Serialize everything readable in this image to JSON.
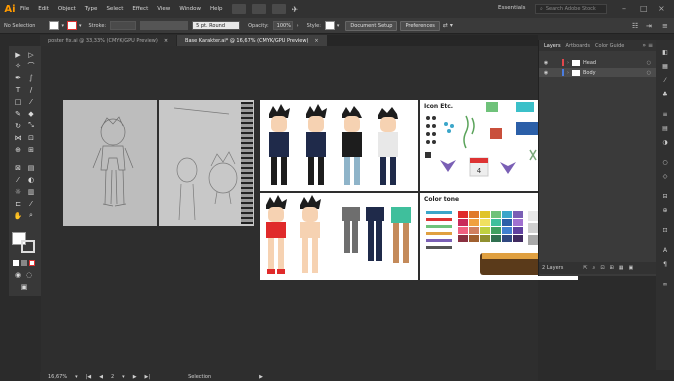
{
  "app": {
    "logo": "Ai"
  },
  "menu": [
    "File",
    "Edit",
    "Object",
    "Type",
    "Select",
    "Effect",
    "View",
    "Window",
    "Help"
  ],
  "workspace": "Essentials",
  "search": {
    "placeholder": "Search Adobe Stock"
  },
  "window_controls": {
    "min": "–",
    "max": "□",
    "close": "×"
  },
  "control_bar": {
    "selection_label": "No Selection",
    "stroke_label": "Stroke:",
    "brush": "5 pt. Round",
    "opacity_label": "Opacity:",
    "opacity_value": "100%",
    "style_label": "Style:",
    "doc_setup": "Document Setup",
    "preferences": "Preferences"
  },
  "tabs": [
    {
      "label": "poster fix.ai @ 33,33% (CMYK/GPU Preview)",
      "close": "×"
    },
    {
      "label": "Base Karakter.ai* @ 16,67% (CMYK/GPU Preview)",
      "close": "×"
    }
  ],
  "artboards": {
    "icon_title": "Icon Etc.",
    "color_title": "Color tone",
    "calendar_number": "4"
  },
  "panel_tabs": [
    "Layers",
    "Artboards",
    "Color Guide"
  ],
  "layers": [
    {
      "name": "Head",
      "color": "#e0474c"
    },
    {
      "name": "Body",
      "color": "#4a7de0"
    }
  ],
  "layers_footer": "2 Layers",
  "status": {
    "zoom": "16,67%",
    "page": "2",
    "tool": "Selection"
  },
  "colors": {
    "accent": "#ff9a00",
    "shirt_navy": "#1f2a4a",
    "shirt_red": "#e02a2a",
    "pants_jeans": "#8fb4c9",
    "pants_teal": "#3fbf9c",
    "shirt_green": "#6fc27a"
  }
}
